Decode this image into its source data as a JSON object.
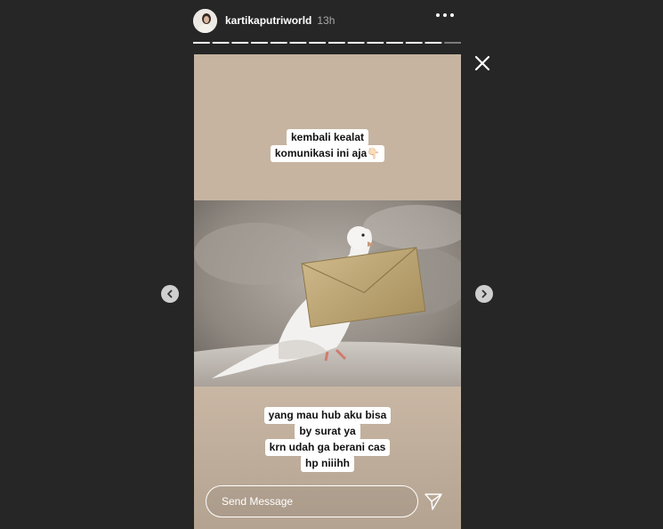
{
  "story": {
    "username": "kartikaputriworld",
    "timestamp": "13h",
    "segments_total": 14,
    "segments_viewed": 13,
    "caption_top": [
      "kembali kealat",
      "komunikasi ini aja👇🏻"
    ],
    "caption_bottom": [
      "yang mau hub aku bisa",
      "by surat ya",
      "krn udah ga berani cas",
      "hp niiihh"
    ]
  },
  "reply": {
    "placeholder": "Send Message"
  },
  "icons": {
    "more": "more-options-icon",
    "close": "close-icon",
    "send": "paper-plane-icon",
    "prev": "chevron-left-icon",
    "next": "chevron-right-icon"
  },
  "colors": {
    "background": "#262626",
    "story_background": "#c6b4a1",
    "text": "#ffffff"
  }
}
